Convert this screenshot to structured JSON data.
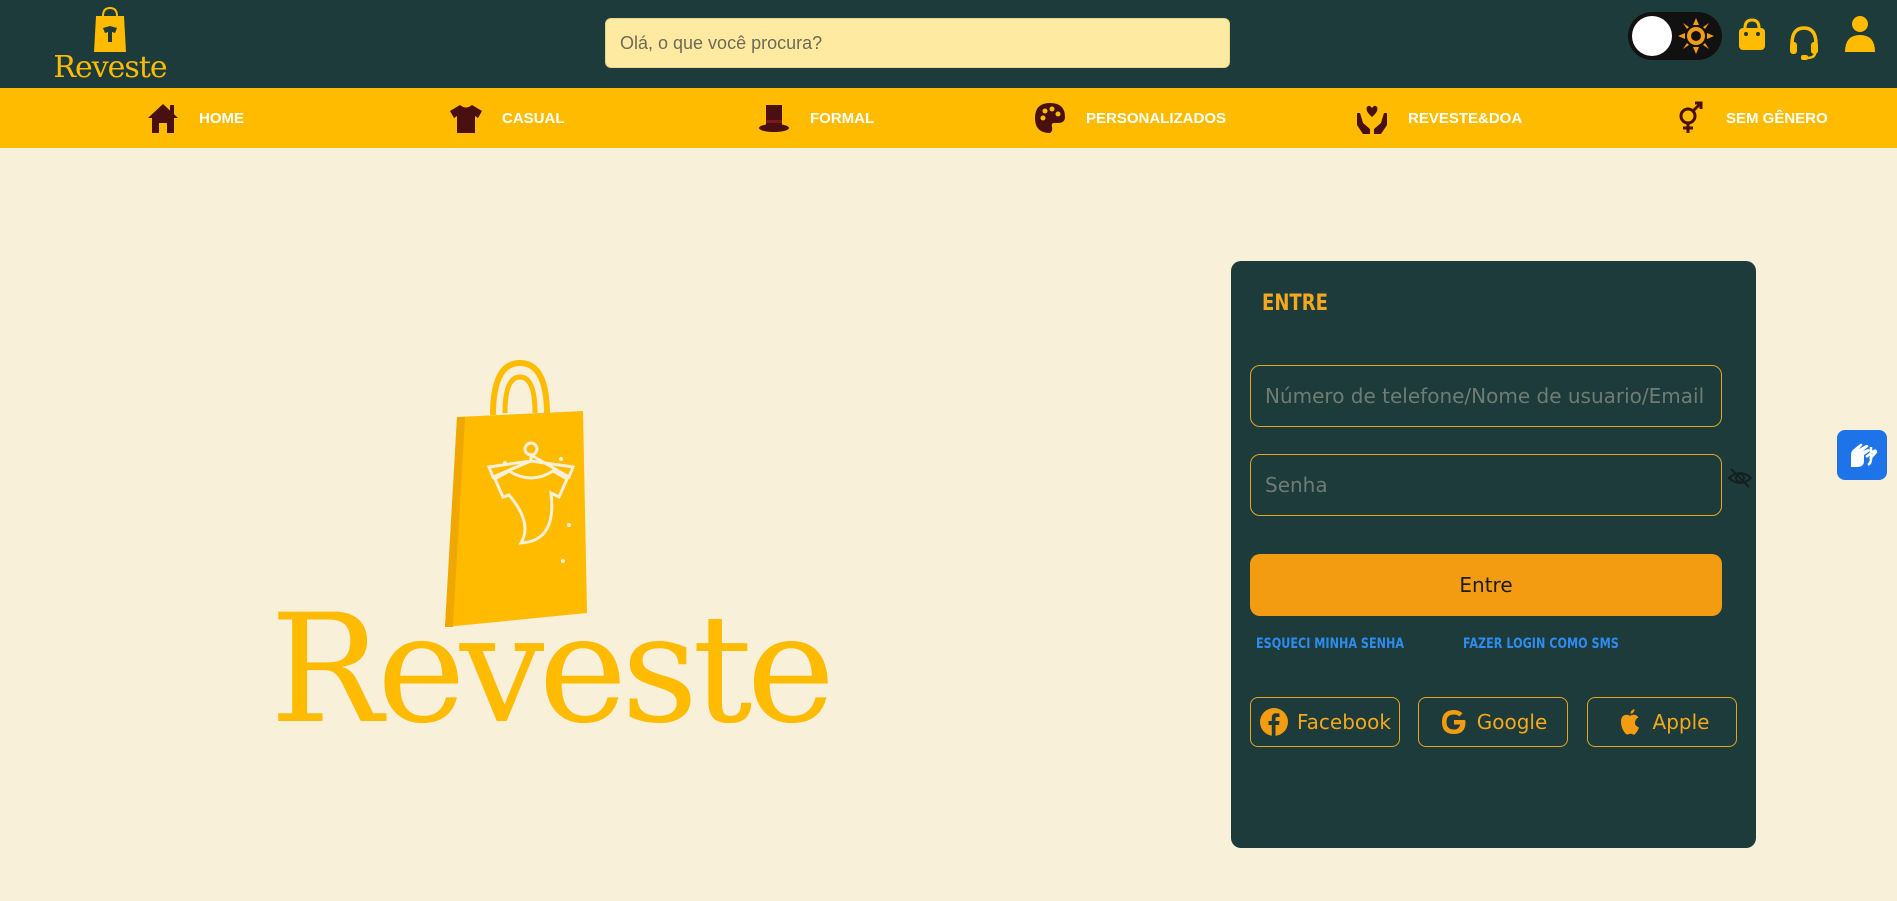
{
  "header": {
    "logo_text": "Reveste",
    "search_placeholder": "Olá, o que você procura?",
    "icons": [
      "theme-toggle",
      "shopping-bag-icon",
      "headset-icon",
      "user-icon"
    ]
  },
  "nav": {
    "items": [
      {
        "label": "HOME",
        "icon": "home-icon"
      },
      {
        "label": "CASUAL",
        "icon": "tshirt-icon"
      },
      {
        "label": "FORMAL",
        "icon": "top-hat-icon"
      },
      {
        "label": "PERSONALIZADOS",
        "icon": "palette-icon"
      },
      {
        "label": "REVESTE&DOA",
        "icon": "hands-heart-icon"
      },
      {
        "label": "SEM GÊNERO",
        "icon": "genderless-icon"
      }
    ]
  },
  "hero": {
    "logo_text": "Reveste"
  },
  "login": {
    "title": "ENTRE",
    "user_placeholder": "Número de telefone/Nome de usuario/Email",
    "password_placeholder": "Senha",
    "submit_label": "Entre",
    "forgot_label": "ESQUECI MINHA SENHA",
    "sms_label": "FAZER LOGIN COMO SMS",
    "social": [
      {
        "label": "Facebook",
        "icon": "facebook-icon"
      },
      {
        "label": "Google",
        "icon": "google-icon"
      },
      {
        "label": "Apple",
        "icon": "apple-icon"
      }
    ]
  },
  "colors": {
    "header_bg": "#1d3b3a",
    "nav_bg": "#ffbb00",
    "page_bg": "#f8f0d8",
    "accent": "#f39c12",
    "nav_icon": "#4a0f0f",
    "link": "#2d8cf0"
  }
}
